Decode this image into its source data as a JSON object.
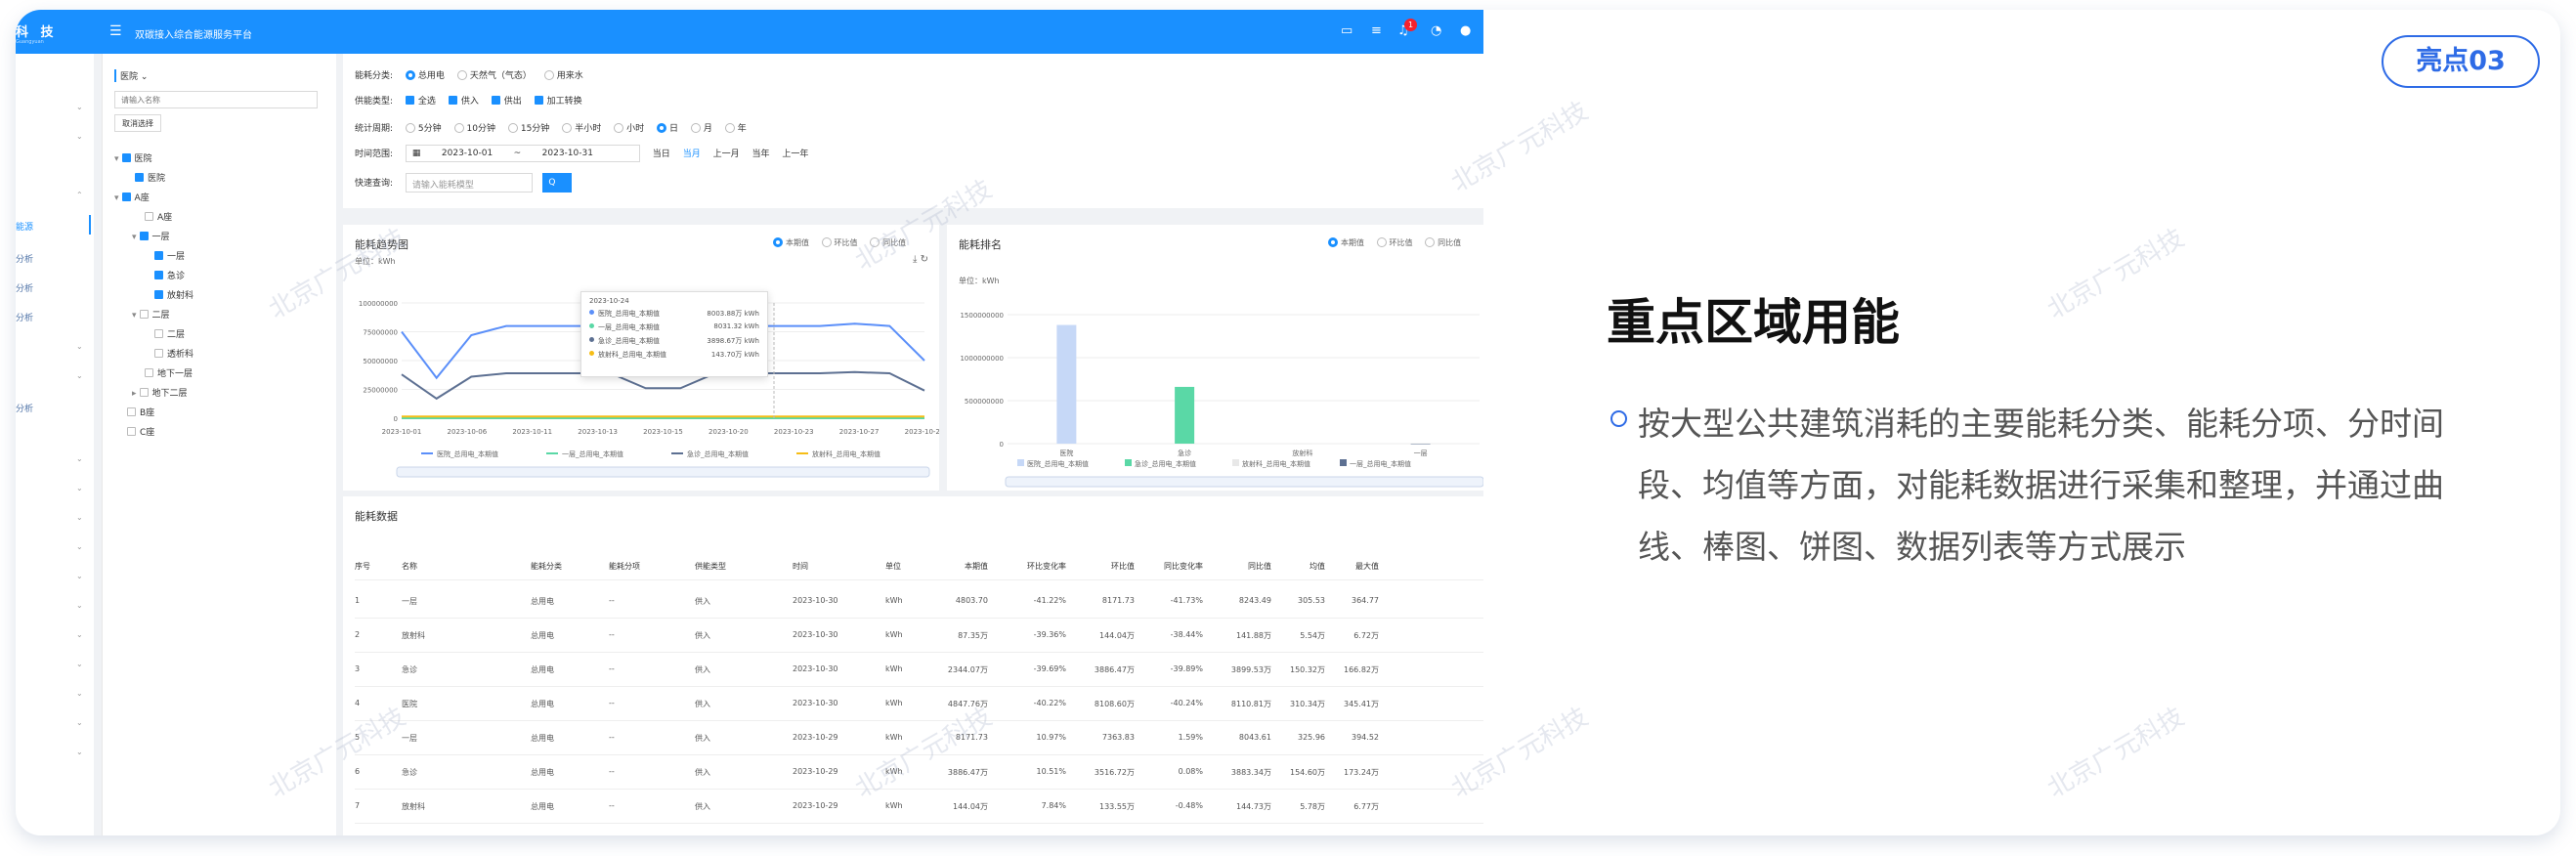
{
  "app": {
    "brand": "科 技",
    "brand_sub": "Guangyuan",
    "title": "双碳接入综合能源服务平台",
    "notification_count": "1"
  },
  "leftnav": {
    "items": [
      "能源",
      "分析",
      "分析",
      "分析",
      "分析"
    ]
  },
  "tree": {
    "selector": "医院",
    "search_placeholder": "请输入名称",
    "cancel_label": "取消选择",
    "nodes": [
      {
        "label": "医院",
        "checked": true
      },
      {
        "label": "医院",
        "checked": true
      },
      {
        "label": "A座",
        "checked": true
      },
      {
        "label": "A座",
        "checked": false
      },
      {
        "label": "一层",
        "checked": true
      },
      {
        "label": "一层",
        "checked": true
      },
      {
        "label": "急诊",
        "checked": true
      },
      {
        "label": "放射科",
        "checked": true
      },
      {
        "label": "二层",
        "checked": false
      },
      {
        "label": "二层",
        "checked": false
      },
      {
        "label": "透析科",
        "checked": false
      },
      {
        "label": "地下一层",
        "checked": false
      },
      {
        "label": "地下二层",
        "checked": false
      },
      {
        "label": "B座",
        "checked": false
      },
      {
        "label": "C座",
        "checked": false
      }
    ]
  },
  "filters": {
    "energy_category_label": "能耗分类:",
    "energy_categories": [
      "总用电",
      "天然气（气态）",
      "用来水"
    ],
    "supply_type_label": "供能类型:",
    "supply_types": [
      "全选",
      "供入",
      "供出",
      "加工转换"
    ],
    "stat_period_label": "统计周期:",
    "stat_periods": [
      "5分钟",
      "10分钟",
      "15分钟",
      "半小时",
      "小时",
      "日",
      "月",
      "年"
    ],
    "time_range_label": "时间范围:",
    "date_start": "2023-10-01",
    "date_sep": "~",
    "date_end": "2023-10-31",
    "quick_ranges": [
      "当日",
      "当月",
      "上一月",
      "当年",
      "上一年"
    ],
    "quick_search_label": "快速查询:",
    "quick_search_placeholder": "请输入能耗模型",
    "search_btn": "Q"
  },
  "trend_panel": {
    "title": "能耗趋势图",
    "unit": "单位：kWh",
    "modes": [
      "本期值",
      "环比值",
      "同比值"
    ],
    "tooltip": {
      "date": "2023-10-24",
      "rows": [
        {
          "name": "医院_总用电_本期值",
          "value": "8003.88万 kWh",
          "color": "#5b8ff9"
        },
        {
          "name": "一层_总用电_本期值",
          "value": "8031.32 kWh",
          "color": "#5ad8a6"
        },
        {
          "name": "急诊_总用电_本期值",
          "value": "3898.67万 kWh",
          "color": "#5d7092"
        },
        {
          "name": "放射科_总用电_本期值",
          "value": "143.70万 kWh",
          "color": "#f6bd16"
        }
      ]
    }
  },
  "rank_panel": {
    "title": "能耗排名",
    "unit": "单位：kWh",
    "modes": [
      "本期值",
      "环比值",
      "同比值"
    ]
  },
  "chart_data": [
    {
      "type": "line",
      "title": "能耗趋势图",
      "ylabel": "单位：kWh",
      "yticks": [
        "100000000",
        "75000000",
        "50000000",
        "25000000",
        "0"
      ],
      "ylim": [
        0,
        100000000
      ],
      "x": [
        "2023-10-01",
        "2023-10-03",
        "2023-10-05",
        "2023-10-07",
        "2023-10-09",
        "2023-10-11",
        "2023-10-13",
        "2023-10-15",
        "2023-10-17",
        "2023-10-19",
        "2023-10-21",
        "2023-10-23",
        "2023-10-25",
        "2023-10-27",
        "2023-10-29",
        "2023-10-31"
      ],
      "xticks": [
        "2023-10-01",
        "2023-10-06",
        "2023-10-11",
        "2023-10-13",
        "2023-10-15",
        "2023-10-20",
        "2023-10-23",
        "2023-10-27",
        "2023-10-29"
      ],
      "series": [
        {
          "name": "医院_总用电_本期值",
          "color": "#5b8ff9",
          "values": [
            75000000,
            35000000,
            72000000,
            80000000,
            80000000,
            80000000,
            80000000,
            52000000,
            52000000,
            80000000,
            80000000,
            80000000,
            80000000,
            82000000,
            80000000,
            50000000
          ]
        },
        {
          "name": "一层_总用电_本期值",
          "color": "#5ad8a6",
          "values": [
            8000,
            8000,
            8000,
            8000,
            8000,
            8000,
            8000,
            8000,
            8000,
            8000,
            8000,
            8000,
            8000,
            8000,
            8000,
            8000
          ]
        },
        {
          "name": "急诊_总用电_本期值",
          "color": "#5d7092",
          "values": [
            38000000,
            17000000,
            36000000,
            39000000,
            39000000,
            39000000,
            39000000,
            26000000,
            26000000,
            39000000,
            39000000,
            39000000,
            39000000,
            40000000,
            39000000,
            24000000
          ]
        },
        {
          "name": "放射科_总用电_本期值",
          "color": "#f6bd16",
          "values": [
            1400000,
            1400000,
            1400000,
            1400000,
            1400000,
            1400000,
            1400000,
            1400000,
            1400000,
            1400000,
            1400000,
            1400000,
            1400000,
            1400000,
            1400000,
            1400000
          ]
        }
      ]
    },
    {
      "type": "bar",
      "title": "能耗排名",
      "ylabel": "单位：kWh",
      "yticks": [
        "1500000000",
        "1000000000",
        "500000000",
        "0"
      ],
      "ylim": [
        0,
        1500000000
      ],
      "categories": [
        "医院",
        "急诊",
        "放射科",
        "一层"
      ],
      "values": [
        1380000000,
        660000000,
        0,
        0
      ],
      "colors": [
        "#c6d8f7",
        "#5ad8a6",
        "#e8e8e8",
        "#5d7092"
      ],
      "legend": [
        "医院_总用电_本期值",
        "急诊_总用电_本期值",
        "放射科_总用电_本期值",
        "一层_总用电_本期值"
      ]
    }
  ],
  "table": {
    "title": "能耗数据",
    "headers": [
      "序号",
      "名称",
      "能耗分类",
      "能耗分项",
      "供能类型",
      "时间",
      "单位",
      "本期值",
      "环比变化率",
      "环比值",
      "同比变化率",
      "同比值",
      "均值",
      "最大值"
    ],
    "rows": [
      [
        "1",
        "一层",
        "总用电",
        "--",
        "供入",
        "2023-10-30",
        "kWh",
        "4803.70",
        "-41.22%",
        "8171.73",
        "-41.73%",
        "8243.49",
        "305.53",
        "364.77"
      ],
      [
        "2",
        "放射科",
        "总用电",
        "--",
        "供入",
        "2023-10-30",
        "kWh",
        "87.35万",
        "-39.36%",
        "144.04万",
        "-38.44%",
        "141.88万",
        "5.54万",
        "6.72万"
      ],
      [
        "3",
        "急诊",
        "总用电",
        "--",
        "供入",
        "2023-10-30",
        "kWh",
        "2344.07万",
        "-39.69%",
        "3886.47万",
        "-39.89%",
        "3899.53万",
        "150.32万",
        "166.82万"
      ],
      [
        "4",
        "医院",
        "总用电",
        "--",
        "供入",
        "2023-10-30",
        "kWh",
        "4847.76万",
        "-40.22%",
        "8108.60万",
        "-40.24%",
        "8110.81万",
        "310.34万",
        "345.41万"
      ],
      [
        "5",
        "一层",
        "总用电",
        "--",
        "供入",
        "2023-10-29",
        "kWh",
        "8171.73",
        "10.97%",
        "7363.83",
        "1.59%",
        "8043.61",
        "325.96",
        "394.52"
      ],
      [
        "6",
        "急诊",
        "总用电",
        "--",
        "供入",
        "2023-10-29",
        "kWh",
        "3886.47万",
        "10.51%",
        "3516.72万",
        "0.08%",
        "3883.34万",
        "154.60万",
        "173.24万"
      ],
      [
        "7",
        "放射科",
        "总用电",
        "--",
        "供入",
        "2023-10-29",
        "kWh",
        "144.04万",
        "7.84%",
        "133.55万",
        "-0.48%",
        "144.73万",
        "5.78万",
        "6.77万"
      ]
    ]
  },
  "watermark": "北京广元科技",
  "highlight": {
    "pill": "亮点03",
    "title": "重点区域用能",
    "body": "按大型公共建筑消耗的主要能耗分类、能耗分项、分时间段、均值等方面，对能耗数据进行采集和整理，并通过曲线、棒图、饼图、数据列表等方式展示"
  }
}
